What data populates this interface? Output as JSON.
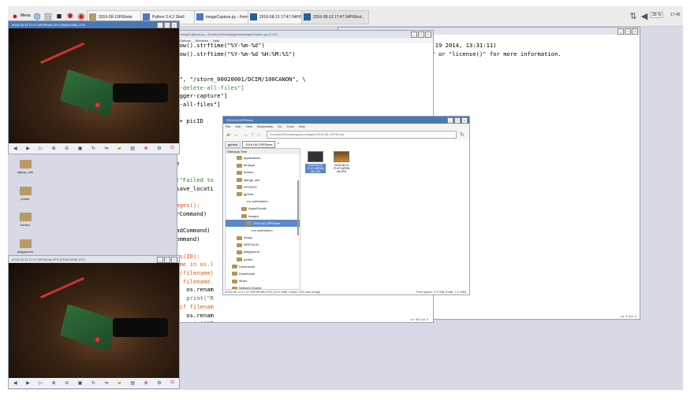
{
  "taskbar": {
    "menu_label": "Menu",
    "buttons": [
      {
        "label": "2016-08-13PiShots"
      },
      {
        "label": "Python 3.4.2 Shell"
      },
      {
        "label": "imageCapture.py - /home/..."
      },
      {
        "label": "2016-08-13 17:47:34PiShot..."
      },
      {
        "label": "2016-08-13 17:47:34PiShot..."
      }
    ],
    "volume": "35 %",
    "clock": "17:46"
  },
  "viewer_top": {
    "title": "2016-08-13 17:47:34PiShots.CR2 (5184x3456) 12%"
  },
  "viewer_bottom": {
    "title": "2016-08-13 17:47:34PiShots.JPG (5184x3456) 12%"
  },
  "desktop_icons": [
    "django_site",
    "printer",
    "bunker",
    "playground"
  ],
  "editor": {
    "title": "imageCapture.py - /home/pi/Desktop/gphoto/imageCapture.py (3.4.2)",
    "menu": [
      "Options",
      "Windows",
      "Help"
    ],
    "lines": [
      {
        "pre": "    ",
        "text": "datetime.now().strftime(\"%Y-%m-%d\")"
      },
      {
        "pre": "    ",
        "text": "datetime.now().strftime(\"%Y-%m-%d %H:%M:%S\")"
      },
      {
        "pre": "    ",
        "text": "hots\""
      },
      {
        "pre": "",
        "text": ""
      },
      {
        "pre": "  ",
        "text": "= [\"--folder\", \"/store_00020001/DCIM/100CANON\", \\"
      },
      {
        "pre": "      ",
        "text": "\"-R\", \"--delete-all-files\"]"
      },
      {
        "pre": "  ",
        "text": "nd = [\"--trigger-capture\"]"
      },
      {
        "pre": "  ",
        "text": "nd = [\"--get-all-files\"]"
      },
      {
        "pre": "",
        "text": ""
      },
      {
        "pre": "  ",
        "text": "= shot_date + picID"
      },
      {
        "pre": "  ",
        "text": "h = \"/home/p"
      },
      {
        "pre": "",
        "text": ""
      },
      {
        "pre": "  ",
        "text": "veFolder():"
      },
      {
        "pre": "",
        "text": ""
      },
      {
        "pre": "  ",
        "text": "akedirs(save"
      },
      {
        "pre": "",
        "text": ""
      },
      {
        "pre": "        ",
        "text": "print(\"Failed to"
      },
      {
        "pre": "    ",
        "text": "os.chdir(save_locati"
      },
      {
        "pre": "",
        "text": ""
      },
      {
        "pre": "",
        "text": "def captureImages():"
      },
      {
        "pre": "    ",
        "text": "gp(triggerCommand)"
      },
      {
        "pre": "    ",
        "text": "sleep(3)"
      },
      {
        "pre": "    ",
        "text": "gp(downloadCommand)"
      },
      {
        "pre": "    ",
        "text": "gp(clearCommand)"
      },
      {
        "pre": "",
        "text": ""
      },
      {
        "pre": "",
        "text": "def renameFiles(ID):"
      },
      {
        "pre": "    ",
        "text": "for filename in os.l"
      },
      {
        "pre": "        ",
        "text": "if len(filename)"
      },
      {
        "pre": "            ",
        "text": "if filename."
      },
      {
        "pre": "                ",
        "text": "os.renam"
      },
      {
        "pre": "                ",
        "text": "print(\"R"
      },
      {
        "pre": "            ",
        "text": "elif filenam"
      },
      {
        "pre": "                ",
        "text": "os.renam"
      },
      {
        "pre": "                ",
        "text": "print(\"R"
      },
      {
        "pre": "",
        "text": ""
      },
      {
        "pre": "",
        "text": "rocess()"
      },
      {
        "pre": "",
        "text": "and)"
      },
      {
        "pre": "",
        "text": "der()"
      },
      {
        "pre": "",
        "text": "s()"
      },
      {
        "pre": "",
        "text": "picID)"
      }
    ],
    "status": "Ln: 46 Col: 0"
  },
  "shell": {
    "title": "Python 3.4.2 Shell",
    "lines": [
      ": 19 2014, 13:31:11)",
      "s\" or \"license()\" for more information."
    ],
    "status": "Ln: 4 Col: 4"
  },
  "file_manager": {
    "title": "2016-08-13PiShots",
    "menu": [
      "File",
      "Edit",
      "View",
      "Bookmarks",
      "Go",
      "Tools",
      "Help"
    ],
    "path": "/home/pi/Desktop/gphoto/images/2016-08-13PiShots",
    "tabs": [
      "gphoto",
      "2016-08-13PiShots"
    ],
    "pane_label": "Directory Tree",
    "tree": [
      {
        "label": "applications",
        "indent": 0
      },
      {
        "label": "arnarga",
        "indent": 0
      },
      {
        "label": "bunker",
        "indent": 0
      },
      {
        "label": "django_site",
        "indent": 0
      },
      {
        "label": "DSYBOX",
        "indent": 0
      },
      {
        "label": "gphoto",
        "indent": 0
      },
      {
        "label": "<no subfolders>",
        "indent": 2
      },
      {
        "label": "AppleDouble",
        "indent": 1
      },
      {
        "label": "images",
        "indent": 1
      },
      {
        "label": "2016-08-13PiShots",
        "indent": 2
      },
      {
        "label": "<no subfolders>",
        "indent": 3
      },
      {
        "label": "nanpy",
        "indent": 0
      },
      {
        "label": "NRF24L01",
        "indent": 0
      },
      {
        "label": "playground",
        "indent": 0
      },
      {
        "label": "printer",
        "indent": 0
      },
      {
        "label": "Documents",
        "indent": -1
      },
      {
        "label": "Downloads",
        "indent": -1
      },
      {
        "label": "Music",
        "indent": -1
      },
      {
        "label": "Network Shares",
        "indent": -1
      }
    ],
    "files": [
      {
        "name": "2016-08-13 17:47:34PiSh ots.CR2"
      },
      {
        "name": "2016-08-13 17:47:34PiSh ots.JPG"
      }
    ],
    "status_left": "2016-08-13 17:47:34PiShots.CR2 (24.0 MiB) Canon CR2 raw image",
    "status_right": "Free space: 2.9 GiB (Total: 7.2 GiB)"
  }
}
